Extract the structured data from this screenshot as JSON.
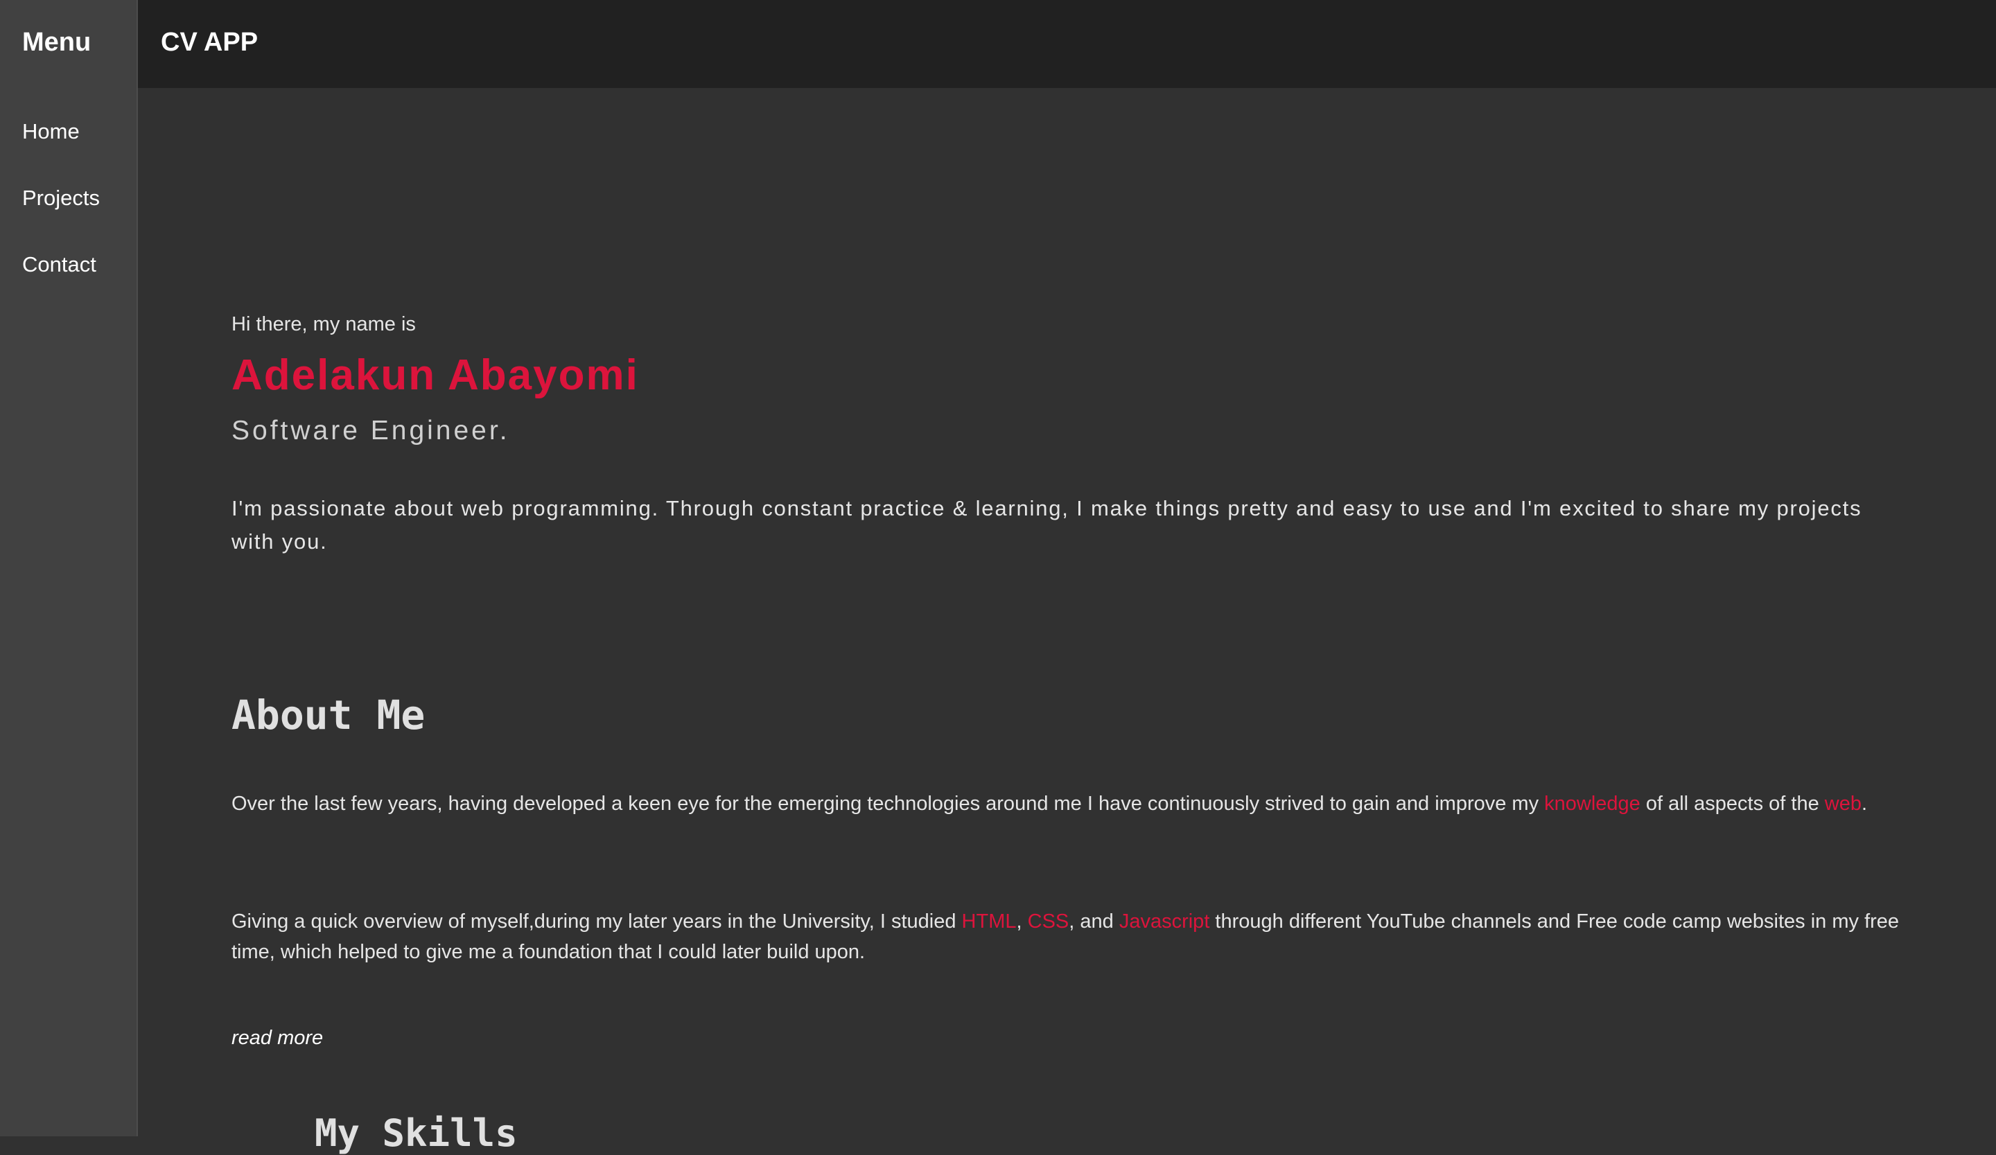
{
  "sidebar": {
    "title": "Menu",
    "items": [
      {
        "label": "Home"
      },
      {
        "label": "Projects"
      },
      {
        "label": "Contact"
      }
    ]
  },
  "header": {
    "title": "CV APP"
  },
  "hero": {
    "greeting": "Hi there, my name is",
    "name": "Adelakun Abayomi",
    "role": "Software Engineer.",
    "intro": "I'm passionate about web programming. Through constant practice & learning, I make things pretty and easy to use and I'm excited to share my projects with you."
  },
  "about": {
    "heading": "About Me",
    "p1": {
      "a": "Over the last few years, having developed a keen eye for the emerging technologies around me I have continuously strived to gain and improve my ",
      "k1": "knowledge",
      "b": " of all aspects of the ",
      "k2": "web",
      "c": "."
    },
    "p2": {
      "a": "Giving a quick overview of myself,during my later years in the University, I studied ",
      "k1": "HTML",
      "s1": ", ",
      "k2": "CSS",
      "s2": ", and ",
      "k3": "Javascript",
      "b": " through different YouTube channels and Free code camp websites in my free time, which helped to give me a foundation that I could later build upon."
    },
    "read_more": "read more"
  },
  "skills": {
    "heading": "My Skills"
  },
  "colors": {
    "accent": "#dc143c",
    "sidebar": "#414141",
    "header": "#212121",
    "background": "#313131"
  }
}
